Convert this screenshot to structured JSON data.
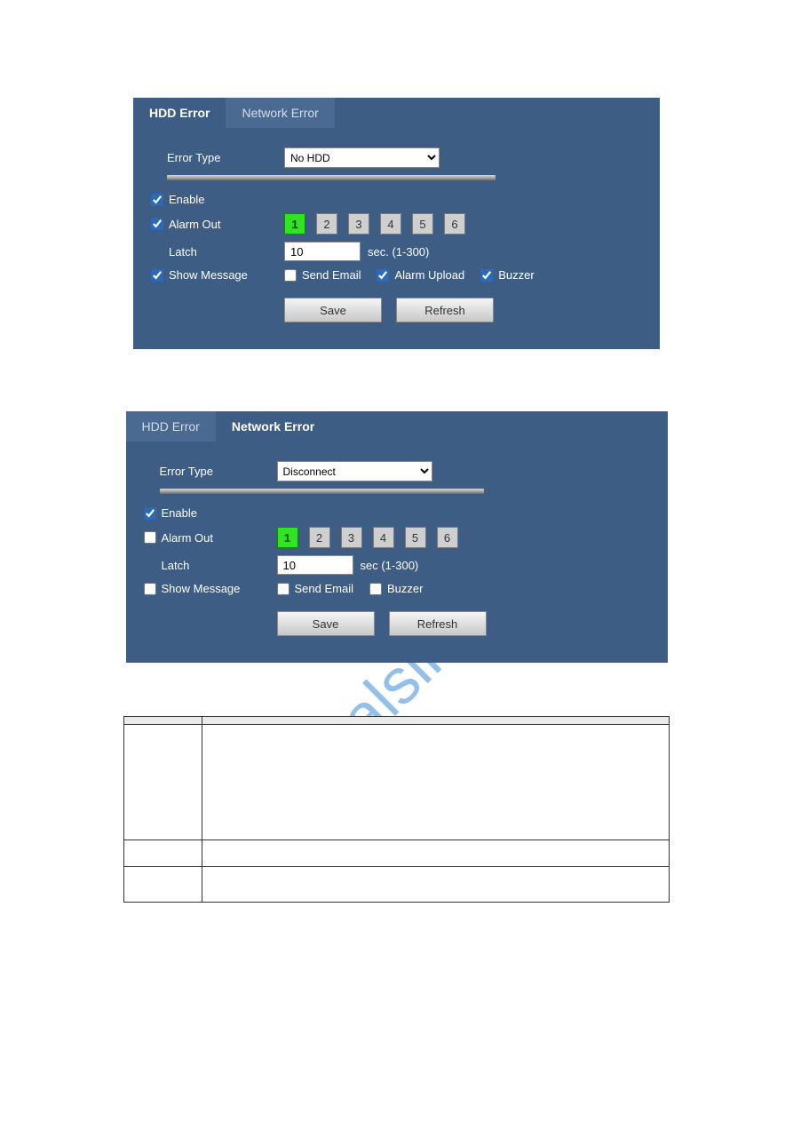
{
  "watermark": "manualslive.com",
  "panel1": {
    "tab_hdd": "HDD Error",
    "tab_net": "Network Error",
    "error_type_label": "Error Type",
    "error_type_value": "No HDD",
    "enable_label": "Enable",
    "enable_checked": true,
    "alarm_out_label": "Alarm Out",
    "alarm_out_checked": true,
    "alarm_buttons": [
      "1",
      "2",
      "3",
      "4",
      "5",
      "6"
    ],
    "alarm_active_idx": 0,
    "latch_label": "Latch",
    "latch_value": "10",
    "latch_unit": "sec. (1-300)",
    "show_message_label": "Show Message",
    "show_message_checked": true,
    "send_email_label": "Send Email",
    "send_email_checked": false,
    "alarm_upload_label": "Alarm Upload",
    "alarm_upload_checked": true,
    "buzzer_label": "Buzzer",
    "buzzer_checked": true,
    "save": "Save",
    "refresh": "Refresh"
  },
  "panel2": {
    "tab_hdd": "HDD Error",
    "tab_net": "Network Error",
    "error_type_label": "Error Type",
    "error_type_value": "Disconnect",
    "enable_label": "Enable",
    "enable_checked": true,
    "alarm_out_label": "Alarm Out",
    "alarm_out_checked": false,
    "alarm_buttons": [
      "1",
      "2",
      "3",
      "4",
      "5",
      "6"
    ],
    "alarm_active_idx": 0,
    "latch_label": "Latch",
    "latch_value": "10",
    "latch_unit": "sec (1-300)",
    "show_message_label": "Show Message",
    "show_message_checked": false,
    "send_email_label": "Send Email",
    "send_email_checked": false,
    "buzzer_label": "Buzzer",
    "buzzer_checked": false,
    "save": "Save",
    "refresh": "Refresh"
  },
  "table": {
    "h_param": "",
    "h_func": "",
    "rows": [
      {
        "p": "",
        "f": ""
      },
      {
        "p": "",
        "f": ""
      },
      {
        "p": "",
        "f": ""
      }
    ]
  }
}
